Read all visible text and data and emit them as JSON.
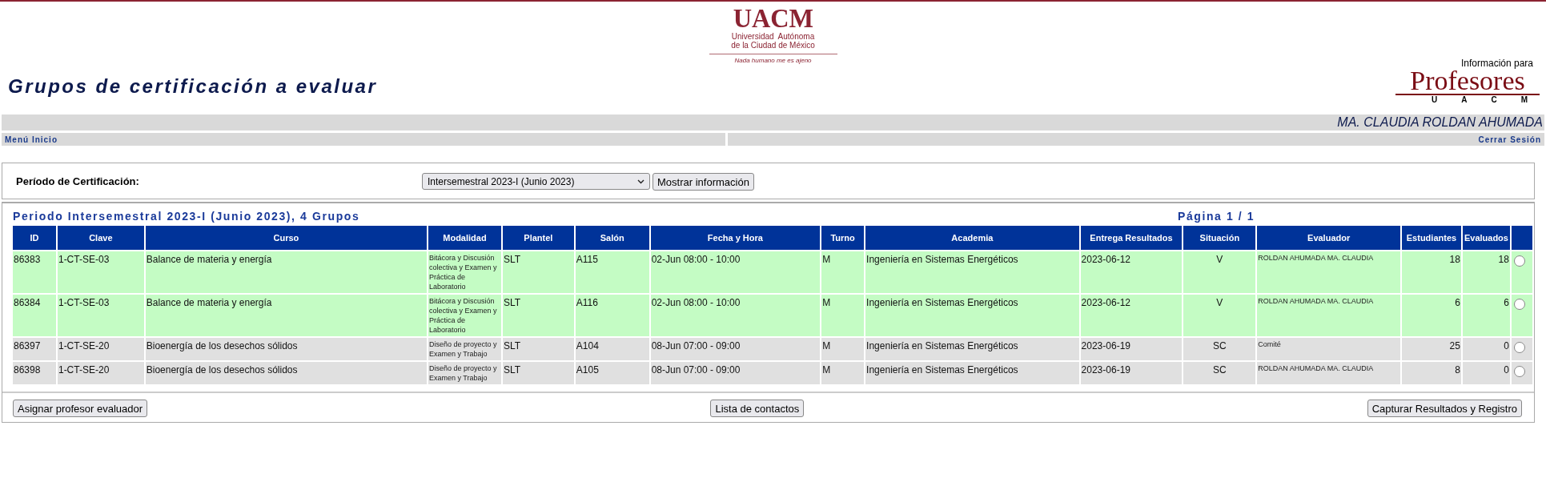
{
  "header": {
    "logo": {
      "name": "UACM",
      "line1": "Universidad  Autónoma",
      "line2": "de la Ciudad de México",
      "motto": "Nada humano me es ajeno"
    },
    "title": "Grupos de certificación a evaluar",
    "portal_logo": {
      "caption": "Información para",
      "name": "Profesores",
      "letters": [
        "U",
        "A",
        "C",
        "M"
      ]
    }
  },
  "user_bar": {
    "name": "MA. CLAUDIA ROLDAN AHUMADA"
  },
  "nav": {
    "left": "Menú Inicio",
    "right": "Cerrar Sesión"
  },
  "filter": {
    "label": "Período de Certificación:",
    "select_value": "Intersemestral 2023-I (Junio 2023)",
    "button": "Mostrar información"
  },
  "results": {
    "heading": "Periodo Intersemestral 2023-I (Junio 2023), 4 Grupos",
    "page": "Página 1 / 1",
    "table": {
      "columns": [
        "ID",
        "Clave",
        "Curso",
        "Modalidad",
        "Plantel",
        "Salón",
        "Fecha y Hora",
        "Turno",
        "Academia",
        "Entrega Resultados",
        "Situación",
        "Evaluador",
        "Estudiantes",
        "Evaluados"
      ],
      "rows": [
        {
          "color": "#c4fcc4",
          "selected": false,
          "cells": [
            "86383",
            "1-CT-SE-03",
            "Balance de materia y energía",
            "Bitácora y Discusión colectiva y Examen y Práctica de Laboratorio",
            "SLT",
            "A115",
            "02-Jun 08:00 - 10:00",
            "M",
            "Ingeniería en Sistemas Energéticos",
            "2023-06-12",
            "V",
            "ROLDAN AHUMADA MA. CLAUDIA",
            "18",
            "18"
          ]
        },
        {
          "color": "#c4fcc4",
          "selected": false,
          "cells": [
            "86384",
            "1-CT-SE-03",
            "Balance de materia y energía",
            "Bitácora y Discusión colectiva y Examen y Práctica de Laboratorio",
            "SLT",
            "A116",
            "02-Jun 08:00 - 10:00",
            "M",
            "Ingeniería en Sistemas Energéticos",
            "2023-06-12",
            "V",
            "ROLDAN AHUMADA MA. CLAUDIA",
            "6",
            "6"
          ]
        },
        {
          "color": "#e0e0e0",
          "selected": false,
          "cells": [
            "86397",
            "1-CT-SE-20",
            "Bioenergía de los desechos sólidos",
            "Diseño de proyecto y Examen y Trabajo",
            "SLT",
            "A104",
            "08-Jun 07:00 - 09:00",
            "M",
            "Ingeniería en Sistemas Energéticos",
            "2023-06-19",
            "SC",
            "Comité",
            "25",
            "0"
          ]
        },
        {
          "color": "#e0e0e0",
          "selected": false,
          "cells": [
            "86398",
            "1-CT-SE-20",
            "Bioenergía de los desechos sólidos",
            "Diseño de proyecto y Examen y Trabajo",
            "SLT",
            "A105",
            "08-Jun 07:00 - 09:00",
            "M",
            "Ingeniería en Sistemas Energéticos",
            "2023-06-19",
            "SC",
            "ROLDAN AHUMADA MA. CLAUDIA",
            "8",
            "0"
          ]
        }
      ]
    },
    "buttons": [
      "Asignar profesor evaluador",
      "Lista de contactos",
      "Capturar Resultados y Registro"
    ]
  }
}
